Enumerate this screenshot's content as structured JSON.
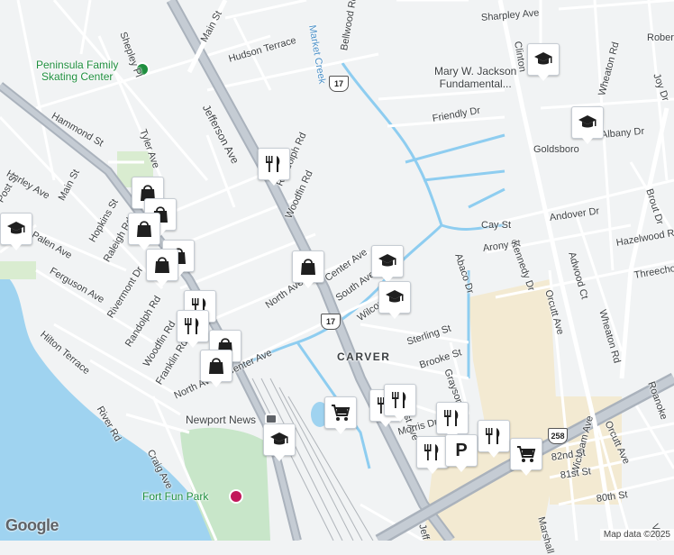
{
  "map": {
    "attribution": "Map data ©2025",
    "logo": "Google",
    "district": "CARVER",
    "places": {
      "skating": "Peninsula Family\nSkating Center",
      "fort_fun": "Fort Fun Park",
      "newport_news": "Newport News",
      "jackson_school": "Mary W. Jackson\nFundamental..."
    },
    "route_shields": [
      "17",
      "17",
      "258"
    ],
    "streets": [
      "Jefferson Ave",
      "Main St",
      "Hudson Terrace",
      "Bellwood Rd",
      "Market Creek",
      "Sharpley Ave",
      "Hammond St",
      "Tyler Ave",
      "Randolph Rd",
      "Woodfin Rd",
      "Hurley Ave",
      "Main St",
      "Post St",
      "Palen Ave",
      "Ferguson Ave",
      "Hilton Terrace",
      "Raleigh Rd",
      "Hopkins St",
      "Rivermont Dr",
      "Randolph Rd",
      "Woodfin Rd",
      "Franklin Rd",
      "North Ave",
      "Center Ave",
      "River Rd",
      "Craig Ave",
      "North Ave",
      "Center Ave",
      "South Ave",
      "Wilcox Ln",
      "Friendly Dr",
      "Goldsboro",
      "Albany Dr",
      "Cay St",
      "Arony St",
      "Kennedy Dr",
      "Andover Dr",
      "Abaco Dr",
      "Adwood Ct",
      "Orcutt Ave",
      "Wheaton Rd",
      "Hazelwood Rd",
      "Sterling St",
      "Brooke St",
      "Grayson Ave",
      "Amherst Ave",
      "Morris Dr",
      "Orcutt Ave",
      "Wickham Ave",
      "82nd St",
      "81st St",
      "80th St",
      "Marshall",
      "Jeff",
      "Shepley Pl",
      "Joy Dr",
      "Robert",
      "Brout Dr",
      "Threechop",
      "Roanoke",
      "Wheaton Rd",
      "Clinton",
      "Vee"
    ],
    "pins": [
      {
        "type": "school",
        "icon": "graduation-cap-icon"
      },
      {
        "type": "school",
        "icon": "graduation-cap-icon"
      },
      {
        "type": "school",
        "icon": "graduation-cap-icon"
      },
      {
        "type": "school",
        "icon": "graduation-cap-icon"
      },
      {
        "type": "school",
        "icon": "graduation-cap-icon"
      },
      {
        "type": "school",
        "icon": "graduation-cap-icon"
      },
      {
        "type": "restaurant",
        "icon": "fork-knife-icon"
      },
      {
        "type": "shopping",
        "icon": "shopping-bag-icon"
      },
      {
        "type": "grocery",
        "icon": "shopping-cart-icon"
      },
      {
        "type": "parking",
        "icon": "parking-icon",
        "label": "P"
      }
    ]
  }
}
